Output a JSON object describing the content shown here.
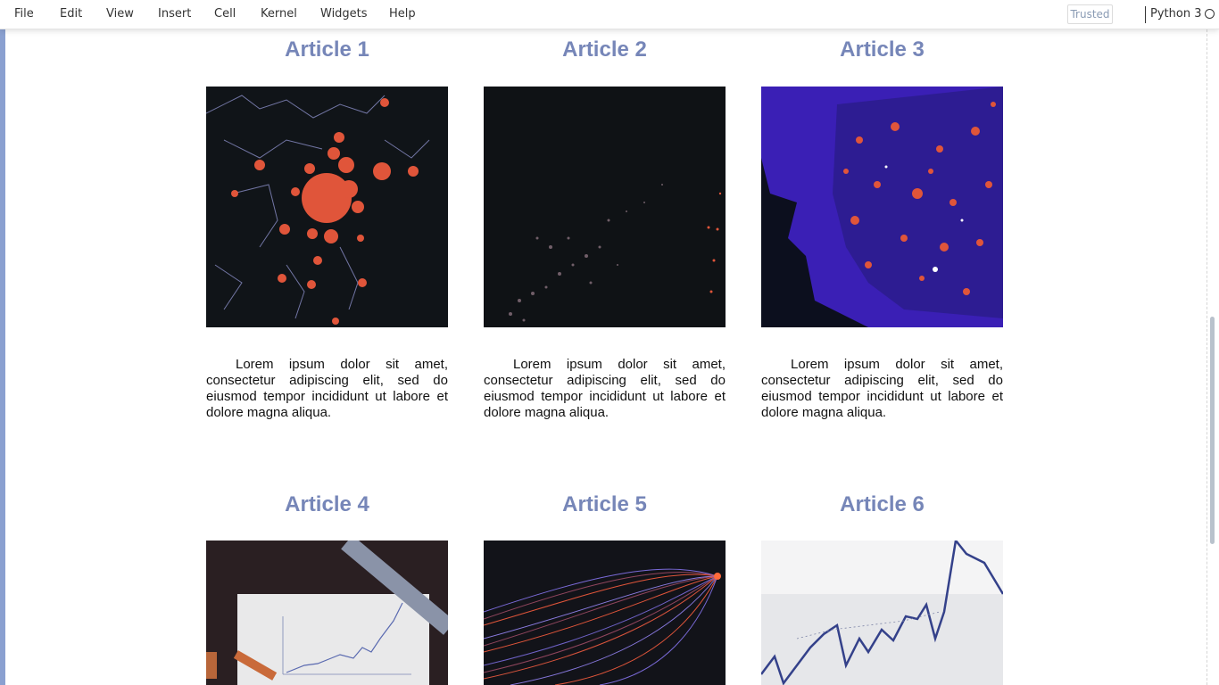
{
  "menubar": {
    "items": [
      "File",
      "Edit",
      "View",
      "Insert",
      "Cell",
      "Kernel",
      "Widgets",
      "Help"
    ],
    "trusted_label": "Trusted",
    "kernel_name": "Python 3"
  },
  "articles": [
    {
      "title": "Article 1",
      "image": "map-china-outbreak",
      "text": "Lorem ipsum dolor sit amet, consectetur adipiscing elit, sed do eiusmod tempor incididunt ut labore et dolore magna aliqua."
    },
    {
      "title": "Article 2",
      "image": "dark-particles",
      "text": "Lorem ipsum dolor sit amet, consectetur adipiscing elit, sed do eiusmod tempor incididunt ut labore et dolore magna aliqua."
    },
    {
      "title": "Article 3",
      "image": "map-usa-dots",
      "text": "Lorem ipsum dolor sit amet, consectetur adipiscing elit, sed do eiusmod tempor incididunt ut labore et dolore magna aliqua."
    },
    {
      "title": "Article 4",
      "image": "desk-chart-ruler",
      "text": ""
    },
    {
      "title": "Article 5",
      "image": "light-streaks",
      "text": ""
    },
    {
      "title": "Article 6",
      "image": "line-graph-paper",
      "text": ""
    }
  ],
  "colors": {
    "title": "#7686b8",
    "cell_bar": "#8aa0d0",
    "accent_orange": "#e0553a"
  }
}
